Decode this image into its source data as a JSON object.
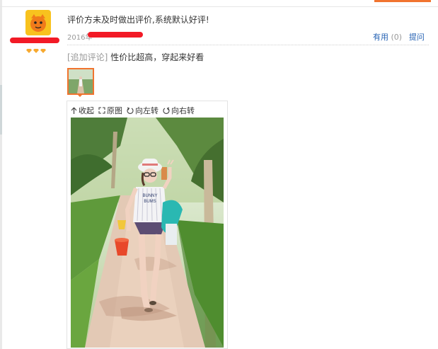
{
  "review": {
    "comment": "评价方未及时做出评价,系统默认好评!",
    "date_prefix": "2016年",
    "useful_label": "有用",
    "useful_count": "(0)",
    "report_label": "提问"
  },
  "followup": {
    "tag": "[追加评论]",
    "text": "性价比超高，穿起来好看"
  },
  "viewer": {
    "collapse_label": "收起",
    "original_label": "原图",
    "rotate_left_label": "向左转",
    "rotate_right_label": "向右转",
    "shirt_text_1": "BUNNY",
    "shirt_text_2": "BUMS"
  },
  "colors": {
    "accent": "#f1742f",
    "link": "#2864b4",
    "redaction": "#f21a26",
    "diamond": "#f7a92f"
  }
}
